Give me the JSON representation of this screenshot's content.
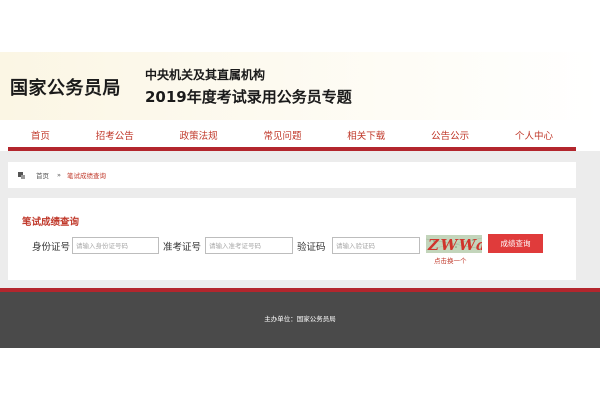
{
  "header": {
    "site_name": "国家公务员局",
    "subtitle_line1": "中央机关及其直属机构",
    "subtitle_line2": "2019年度考试录用公务员专题"
  },
  "nav": {
    "items": [
      {
        "label": "首页"
      },
      {
        "label": "招考公告"
      },
      {
        "label": "政策法规"
      },
      {
        "label": "常见问题"
      },
      {
        "label": "相关下载"
      },
      {
        "label": "公告公示"
      },
      {
        "label": "个人中心"
      }
    ]
  },
  "breadcrumb": {
    "home": "首页",
    "separator": "»",
    "current": "笔试成绩查询"
  },
  "query": {
    "title": "笔试成绩查询",
    "id_label": "身份证号",
    "id_placeholder": "请输入身份证号码",
    "admission_label": "准考证号",
    "admission_placeholder": "请输入准考证号码",
    "captcha_label": "验证码",
    "captcha_placeholder": "请输入验证码",
    "captcha_text": "ZWWa",
    "captcha_refresh": "点击换一个",
    "submit_label": "成绩查询"
  },
  "footer": {
    "sponsor": "主办单位：国家公务员局"
  },
  "colors": {
    "accent_red": "#b3262d",
    "link_red": "#c0392b",
    "button_red": "#e03b3b",
    "footer_gray": "#4a4a4a",
    "band_gray": "#ececec"
  }
}
